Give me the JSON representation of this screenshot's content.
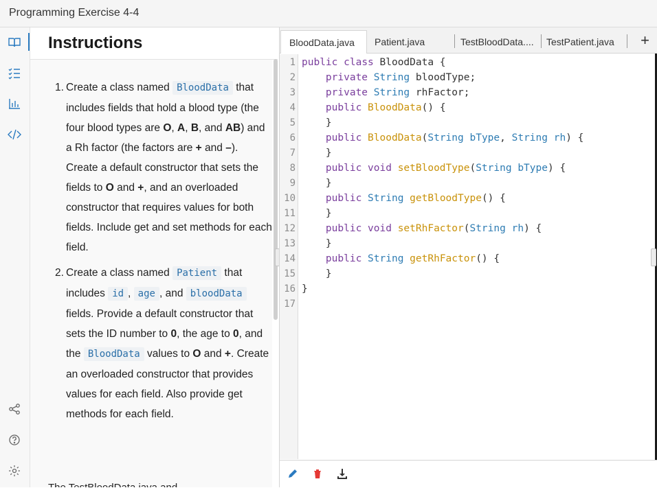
{
  "app": {
    "title": "Programming Exercise 4-4"
  },
  "rail": {
    "items": [
      {
        "icon": "book-icon",
        "active": true
      },
      {
        "icon": "checklist-icon"
      },
      {
        "icon": "bar-chart-icon"
      },
      {
        "icon": "code-icon"
      }
    ],
    "bottom": [
      {
        "icon": "share-icon"
      },
      {
        "icon": "help-icon"
      },
      {
        "icon": "gear-icon"
      }
    ]
  },
  "instructions": {
    "heading": "Instructions",
    "item1": {
      "num": "1.",
      "t1": "Create a class named ",
      "code1": "BloodData",
      "t2": "that includes fields that hold a blood type (the four blood types are ",
      "b1": "O",
      "t3": ", ",
      "b2": "A",
      "t4": ", ",
      "b3": "B",
      "t5": ", and ",
      "b4": "AB",
      "t6": ") and a Rh factor (the factors are ",
      "b5": "+",
      "t7": " and ",
      "b6": "–",
      "t8": "). Create a default constructor that sets the fields to ",
      "b7": "O",
      "t9": " and ",
      "b8": "+",
      "t10": ", and an overloaded constructor that requires values for both fields. Include get and set methods for each field."
    },
    "item2": {
      "num": "2.",
      "t1": "Create a class named ",
      "code1": "Patient",
      "t2": " that includes ",
      "code2": "id",
      "t3": ", ",
      "code3": "age",
      "t4": ", and ",
      "code4": "bloodData",
      "t5": " fields. Provide a default constructor that sets the ID number to ",
      "b1": "0",
      "t6": ", the age to ",
      "b2": "0",
      "t7": ", and the ",
      "code5": "BloodData",
      "t8": " values to ",
      "b3": "O",
      "t9": " and ",
      "b4": "+",
      "t10": ". Create an overloaded constructor that provides values for each field. Also provide get methods for each field."
    },
    "tail": "The TestBloodData.java and"
  },
  "editor": {
    "tabs": [
      "BloodData.java",
      "Patient.java",
      "TestBloodData....",
      "TestPatient.java"
    ],
    "add_tab": "+",
    "line_numbers": [
      "1",
      "2",
      "3",
      "4",
      "5",
      "6",
      "7",
      "8",
      "9",
      "10",
      "11",
      "12",
      "13",
      "14",
      "15",
      "16",
      "17"
    ],
    "lines": [
      "public class BloodData {",
      "    private String bloodType;",
      "    private String rhFactor;",
      "    public BloodData() {",
      "    }",
      "    public BloodData(String bType, String rh) {",
      "    }",
      "    public void setBloodType(String bType) {",
      "    }",
      "    public String getBloodType() {",
      "    }",
      "    public void setRhFactor(String rh) {",
      "    }",
      "    public String getRhFactor() {",
      "    }",
      "}",
      ""
    ],
    "footer_icons": [
      "pencil-icon",
      "trash-icon",
      "download-icon"
    ],
    "colors": {
      "keyword": "#7a3e9d",
      "type": "#2e7cb3",
      "method": "#c9920a",
      "accent": "#2b7bc0",
      "trash": "#e53935"
    }
  }
}
